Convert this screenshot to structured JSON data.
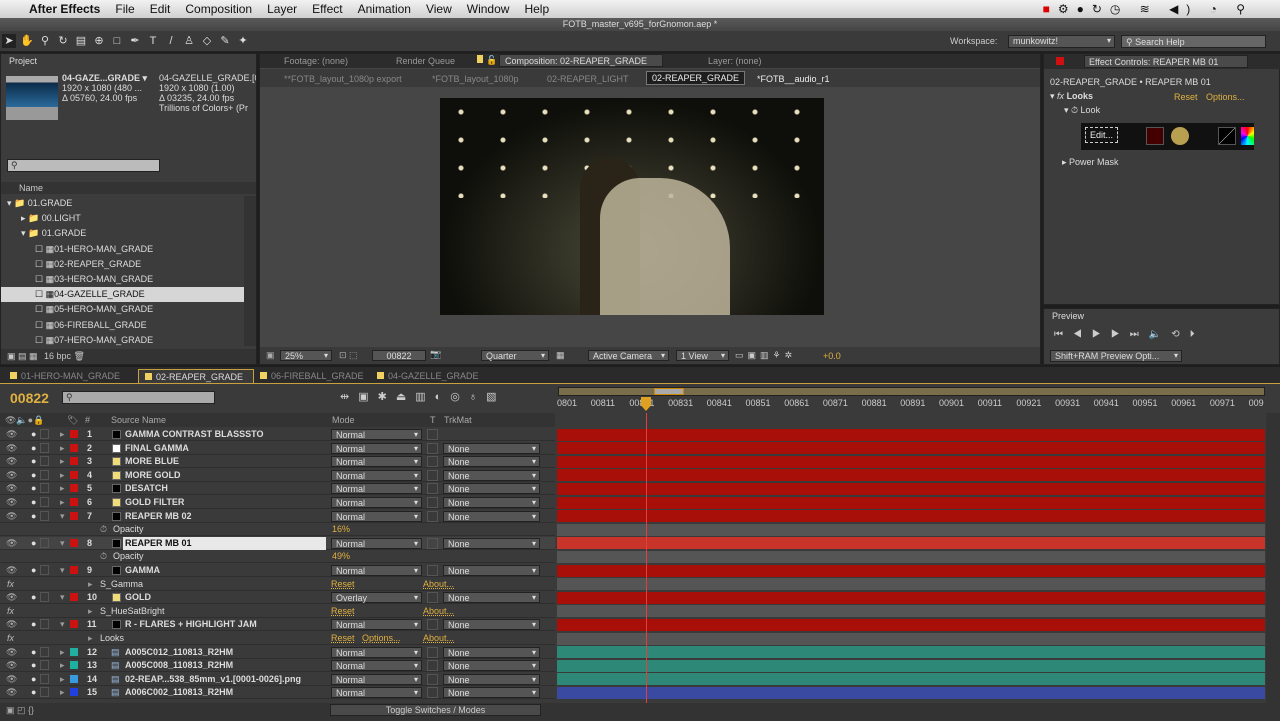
{
  "menubar": {
    "app": "After Effects",
    "items": [
      "File",
      "Edit",
      "Composition",
      "Layer",
      "Effect",
      "Animation",
      "View",
      "Window",
      "Help"
    ]
  },
  "window_title": "FOTB_master_v695_forGnomon.aep *",
  "toolbar": {
    "workspace_label": "Workspace:",
    "workspace_value": "munkowitz!",
    "search_placeholder": "Search Help"
  },
  "project": {
    "tab": "Project",
    "name": "04-GAZE...GRADE ▾",
    "res": "1920 x 1080  (480 ...",
    "dur": "Δ 05760, 24.00 fps",
    "name2": "04-GAZELLE_GRADE.[0",
    "res2": "1920 x 1080 (1.00)",
    "dur2": "Δ 03235, 24.00 fps",
    "colors": "Trillions of Colors+ (Pr",
    "col_name": "Name",
    "bpc": "16 bpc",
    "tree": [
      {
        "label": "01.GRADE",
        "level": 0
      },
      {
        "label": "00.LIGHT",
        "level": 1
      },
      {
        "label": "01.GRADE",
        "level": 1
      },
      {
        "label": "01-HERO-MAN_GRADE",
        "level": 2
      },
      {
        "label": "02-REAPER_GRADE",
        "level": 2
      },
      {
        "label": "03-HERO-MAN_GRADE",
        "level": 2
      },
      {
        "label": "04-GAZELLE_GRADE",
        "level": 2,
        "selected": true
      },
      {
        "label": "05-HERO-MAN_GRADE",
        "level": 2
      },
      {
        "label": "06-FIREBALL_GRADE",
        "level": 2
      },
      {
        "label": "07-HERO-MAN_GRADE",
        "level": 2
      }
    ]
  },
  "viewer": {
    "tabs": [
      "Footage: (none)",
      "Render Queue",
      "Composition: 02-REAPER_GRADE",
      "Layer: (none)"
    ],
    "breadcrumbs": [
      "**FOTB_layout_1080p export",
      "*FOTB_layout_1080p",
      "02-REAPER_LIGHT",
      "02-REAPER_GRADE",
      "*FOTB__audio_r1"
    ],
    "zoom": "25%",
    "timecode": "00822",
    "resolution": "Quarter",
    "camera": "Active Camera",
    "views": "1 View",
    "exposure": "+0.0"
  },
  "effect_controls": {
    "tab": "Effect Controls: REAPER MB 01",
    "path": "02-REAPER_GRADE • REAPER MB 01",
    "effect": "Looks",
    "reset": "Reset",
    "options": "Options...",
    "look": "Look",
    "edit": "Edit...",
    "power_mask": "Power Mask"
  },
  "preview": {
    "tab": "Preview",
    "ram": "Shift+RAM Preview Opti..."
  },
  "timeline": {
    "tabs": [
      {
        "label": "01-HERO-MAN_GRADE"
      },
      {
        "label": "02-REAPER_GRADE",
        "active": true
      },
      {
        "label": "06-FIREBALL_GRADE"
      },
      {
        "label": "04-GAZELLE_GRADE"
      }
    ],
    "timecode": "00822",
    "col_source": "Source Name",
    "col_mode": "Mode",
    "col_t": "T",
    "col_trkmat": "TrkMat",
    "col_num": "#",
    "ruler": [
      "0801",
      "00811",
      "00821",
      "00831",
      "00841",
      "00851",
      "00861",
      "00871",
      "00881",
      "00891",
      "00901",
      "00911",
      "00921",
      "00931",
      "00941",
      "00951",
      "00961",
      "00971",
      "009"
    ],
    "toggle": "Toggle Switches / Modes",
    "rows": [
      {
        "n": "1",
        "name": "GAMMA CONTRAST BLASSSTO",
        "swatch": "#000000",
        "label": "#cc1111",
        "mode": "Normal",
        "trk": ""
      },
      {
        "n": "2",
        "name": "FINAL GAMMA",
        "swatch": "#ffffff",
        "label": "#cc1111",
        "mode": "Normal",
        "trk": "None"
      },
      {
        "n": "3",
        "name": "MORE BLUE",
        "swatch": "#f0dc78",
        "label": "#cc1111",
        "mode": "Normal",
        "trk": "None"
      },
      {
        "n": "4",
        "name": "MORE GOLD",
        "swatch": "#f0dc78",
        "label": "#cc1111",
        "mode": "Normal",
        "trk": "None"
      },
      {
        "n": "5",
        "name": "DESATCH",
        "swatch": "#000000",
        "label": "#cc1111",
        "mode": "Normal",
        "trk": "None"
      },
      {
        "n": "6",
        "name": "GOLD FILTER",
        "swatch": "#f0dc78",
        "label": "#cc1111",
        "mode": "Normal",
        "trk": "None"
      },
      {
        "n": "7",
        "name": "REAPER MB 02",
        "swatch": "#000000",
        "label": "#cc1111",
        "mode": "Normal",
        "trk": "None",
        "open": true
      },
      {
        "prop": "Opacity",
        "value": "16%"
      },
      {
        "n": "8",
        "name": "REAPER MB 01",
        "swatch": "#000000",
        "label": "#cc1111",
        "mode": "Normal",
        "trk": "None",
        "open": true,
        "selected": true
      },
      {
        "prop": "Opacity",
        "value": "49%"
      },
      {
        "n": "9",
        "name": "GAMMA",
        "swatch": "#000000",
        "label": "#cc1111",
        "mode": "Normal",
        "trk": "None",
        "open": true
      },
      {
        "fx": "S_Gamma",
        "reset": "Reset",
        "about": "About..."
      },
      {
        "n": "10",
        "name": "GOLD",
        "swatch": "#f0dc78",
        "label": "#cc1111",
        "mode": "Overlay",
        "trk": "None",
        "open": true
      },
      {
        "fx": "S_HueSatBright",
        "reset": "Reset",
        "about": "About..."
      },
      {
        "n": "11",
        "name": "R - FLARES + HIGHLIGHT JAM",
        "swatch": "#000000",
        "label": "#cc1111",
        "mode": "Normal",
        "trk": "None",
        "open": true
      },
      {
        "fx": "Looks",
        "reset": "Reset",
        "options": "Options...",
        "about": "About..."
      },
      {
        "n": "12",
        "name": "A005C012_110813_R2HM",
        "swatch": "footage",
        "label": "#20b0a0",
        "mode": "Normal",
        "trk": "None",
        "bar": "#2e8878"
      },
      {
        "n": "13",
        "name": "A005C008_110813_R2HM",
        "swatch": "footage",
        "label": "#20b0a0",
        "mode": "Normal",
        "trk": "None",
        "bar": "#2e8878"
      },
      {
        "n": "14",
        "name": "02-REAP...538_85mm_v1.[0001-0026].png",
        "swatch": "footage",
        "label": "#3a9ae0",
        "mode": "Normal",
        "trk": "None",
        "bar": "#2e8878"
      },
      {
        "n": "15",
        "name": "A006C002_110813_R2HM",
        "swatch": "footage",
        "label": "#2040e0",
        "mode": "Normal",
        "trk": "None",
        "bar": "#3a4aa0"
      }
    ]
  },
  "colors": {
    "accent": "#e0b040",
    "layer_bar": "#a80f08",
    "selected_bar": "#c8342a"
  }
}
